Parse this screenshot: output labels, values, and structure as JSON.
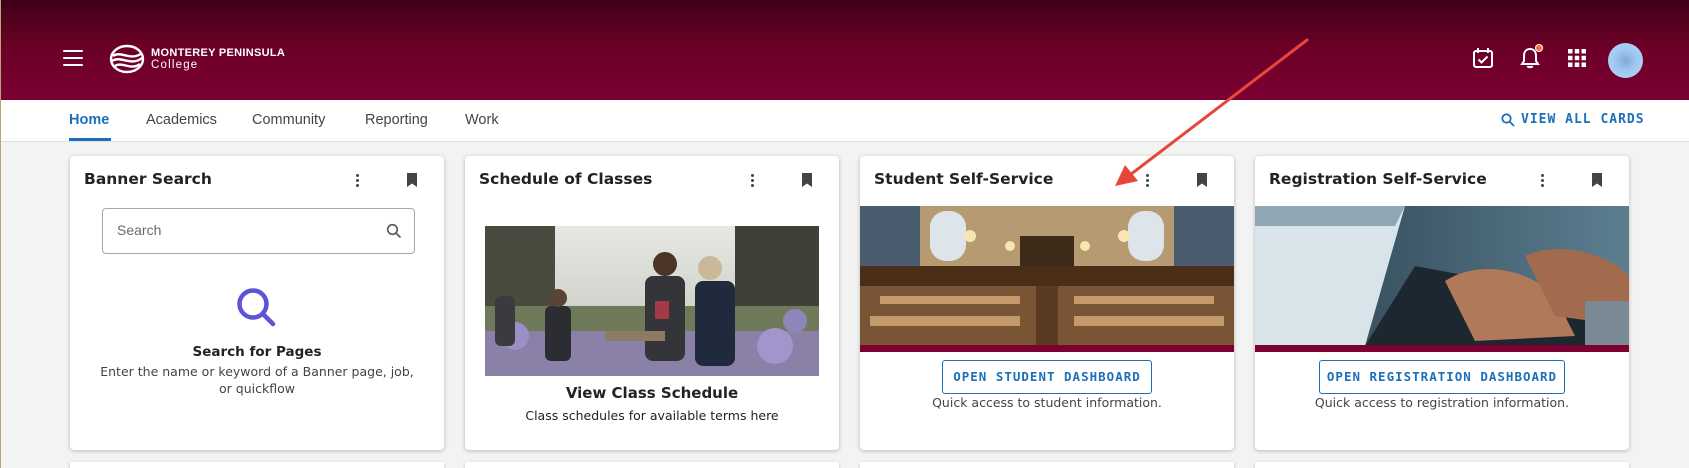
{
  "header": {
    "logo_line1": "MONTEREY PENINSULA",
    "logo_line2": "College",
    "colors": {
      "brand": "#7c0032",
      "accent": "#1c6fba",
      "notification": "#ff6b3d"
    }
  },
  "tabs": [
    {
      "label": "Home",
      "active": true
    },
    {
      "label": "Academics",
      "active": false
    },
    {
      "label": "Community",
      "active": false
    },
    {
      "label": "Reporting",
      "active": false
    },
    {
      "label": "Work",
      "active": false
    }
  ],
  "view_all_label": "VIEW ALL CARDS",
  "cards": {
    "banner": {
      "title": "Banner Search",
      "search_placeholder": "Search",
      "heading": "Search for Pages",
      "description": "Enter the name or keyword of a Banner page, job, or quickflow"
    },
    "schedule": {
      "title": "Schedule of Classes",
      "heading": "View Class Schedule",
      "description": "Class schedules for available terms here"
    },
    "student": {
      "title": "Student Self-Service",
      "button": "OPEN STUDENT DASHBOARD",
      "description": "Quick access to student information."
    },
    "registration": {
      "title": "Registration Self-Service",
      "button": "OPEN REGISTRATION DASHBOARD",
      "description": "Quick access to registration information."
    }
  },
  "icons": {
    "menu": "hamburger-icon",
    "calendar": "calendar-check-icon",
    "bell": "bell-icon",
    "apps": "apps-grid-icon",
    "search": "search-icon",
    "more": "kebab-menu-icon",
    "bookmark": "bookmark-icon"
  }
}
